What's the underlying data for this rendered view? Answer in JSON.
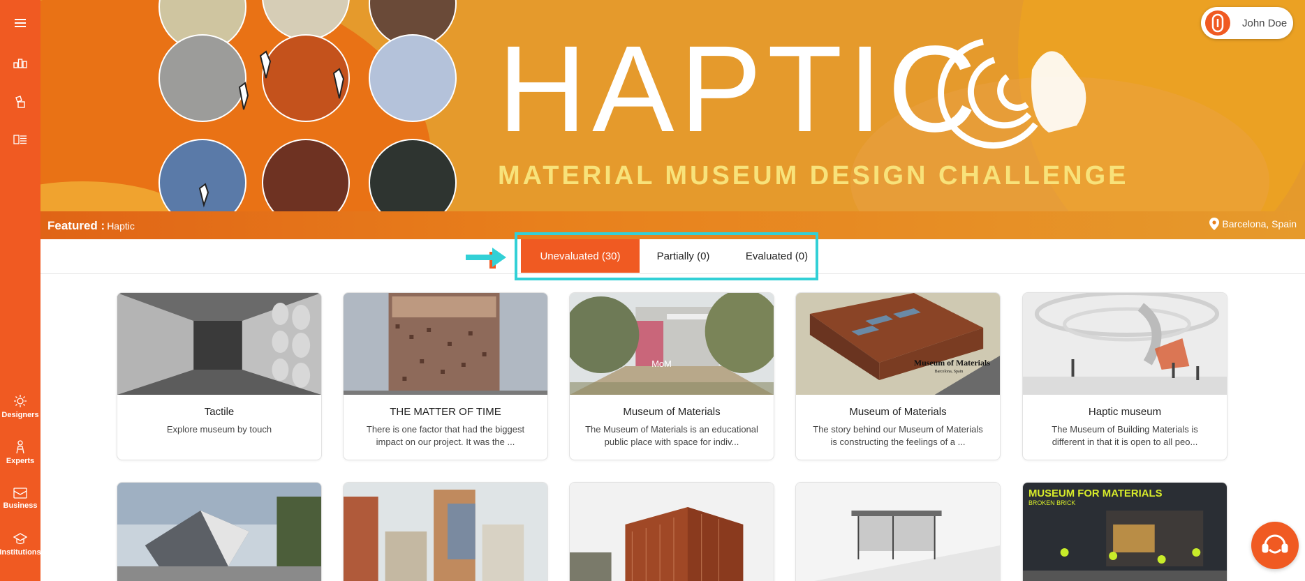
{
  "sidebar": {
    "items": [
      {
        "icon": "menu-icon",
        "label": ""
      },
      {
        "icon": "dashboard-icon",
        "label": ""
      },
      {
        "icon": "projects-icon",
        "label": ""
      },
      {
        "icon": "list-icon",
        "label": ""
      },
      {
        "icon": "designers-icon",
        "label": "Designers"
      },
      {
        "icon": "experts-icon",
        "label": "Experts"
      },
      {
        "icon": "business-icon",
        "label": "Business"
      },
      {
        "icon": "institutions-icon",
        "label": "Institutions"
      }
    ]
  },
  "banner": {
    "title": "HAPTIC",
    "subtitle": "MATERIAL MUSEUM DESIGN CHALLENGE",
    "featured_label": "Featured :",
    "featured_name": "Haptic",
    "location": "Barcelona, Spain"
  },
  "user": {
    "name": "John Doe"
  },
  "tabs": [
    {
      "label": "Unevaluated (30)",
      "active": true
    },
    {
      "label": "Partially (0)",
      "active": false
    },
    {
      "label": "Evaluated (0)",
      "active": false
    }
  ],
  "projects": [
    {
      "title": "Tactile",
      "description": "Explore museum by touch"
    },
    {
      "title": "THE MATTER OF TIME",
      "description": "There is one factor that had the biggest impact on our project. It was the ..."
    },
    {
      "title": "Museum of Materials",
      "description": "The Museum of Materials is an educational public place with space for indiv..."
    },
    {
      "title": "Museum of Materials",
      "description": "The story behind our Museum of Materials is constructing the feelings of a ..."
    },
    {
      "title": "Haptic museum",
      "description": "The Museum of Building Materials is different in that it is open to all peo..."
    },
    {
      "title": "",
      "description": ""
    },
    {
      "title": "",
      "description": ""
    },
    {
      "title": "",
      "description": ""
    },
    {
      "title": "",
      "description": ""
    },
    {
      "title": "",
      "description": ""
    }
  ],
  "thumb_text": {
    "mom": "MoM",
    "museum_of_materials": "Museum of Materials",
    "barcelona": "Barcelona, Spain",
    "museum_for_materials": "MUSEUM FOR MATERIALS",
    "broken_brick": "BROKEN BRICK"
  },
  "colors": {
    "accent": "#f05a22",
    "highlight": "#32d0d6",
    "banner": "#e49a2a"
  }
}
